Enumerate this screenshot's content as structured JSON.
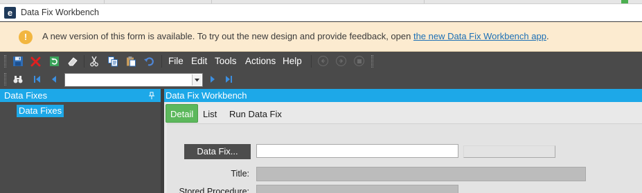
{
  "window": {
    "title": "Data Fix Workbench",
    "logo_letter": "e"
  },
  "banner": {
    "icon": "warning-circle-icon",
    "icon_glyph": "!",
    "message": "A new version of this form is available. To try out the new design and provide feedback, open ",
    "link_text": "the new Data Fix Workbench app",
    "message_end": "."
  },
  "toolbar": {
    "icons": [
      "save-icon",
      "delete-icon",
      "refresh-icon",
      "clear-icon",
      "cut-icon",
      "copy-icon",
      "paste-icon",
      "undo-icon"
    ],
    "menus": [
      "File",
      "Edit",
      "Tools",
      "Actions",
      "Help"
    ],
    "nav_icons": [
      "back-icon",
      "forward-icon",
      "stop-icon"
    ]
  },
  "navbar": {
    "icons": [
      "search-binoculars-icon",
      "first-record-icon",
      "previous-record-icon",
      "next-record-icon",
      "last-record-icon"
    ],
    "record_value": ""
  },
  "left_pane": {
    "title": "Data Fixes",
    "tree_items": [
      "Data Fixes"
    ]
  },
  "right_pane": {
    "title": "Data Fix Workbench",
    "tabs": [
      "Detail",
      "List",
      "Run Data Fix"
    ],
    "active_tab": "Detail"
  },
  "form": {
    "data_fix_button": "Data Fix...",
    "data_fix_value": "",
    "title_label": "Title:",
    "title_value": "",
    "stored_procedure_label": "Stored Procedure:",
    "stored_procedure_value": ""
  },
  "colors": {
    "accent": "#1da8e8",
    "active_tab": "#5cb85c",
    "banner_bg": "#fcebd0",
    "toolbar_bg": "#4a4a4a",
    "link": "#1b6fb5"
  }
}
